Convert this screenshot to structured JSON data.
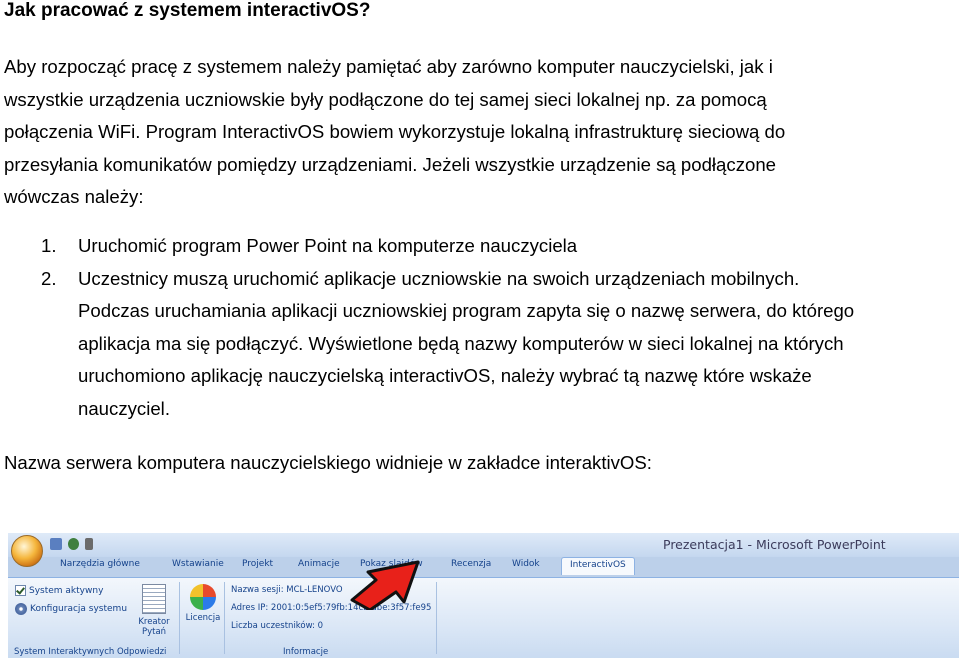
{
  "title": "Jak pracować z systemem interactivOS?",
  "intro_lines": [
    "Aby rozpocząć pracę z systemem należy pamiętać aby zarówno komputer nauczycielski, jak i",
    "wszystkie urządzenia uczniowskie były podłączone do tej samej sieci lokalnej np. za pomocą",
    "połączenia WiFi. Program InteractivOS bowiem wykorzystuje lokalną infrastrukturę sieciową do",
    "przesyłania komunikatów pomiędzy urządzeniami. Jeżeli wszystkie urządzenie są podłączone",
    "wówczas należy:"
  ],
  "steps": [
    {
      "number": "1.",
      "lines": [
        "Uruchomić program Power Point na komputerze nauczyciela"
      ]
    },
    {
      "number": "2.",
      "lines": [
        "Uczestnicy muszą uruchomić aplikacje uczniowskie na swoich urządzeniach mobilnych.",
        "Podczas uruchamiania aplikacji uczniowskiej program zapyta się o nazwę serwera, do którego",
        "aplikacja ma się podłączyć. Wyświetlone będą nazwy komputerów w sieci lokalnej na których",
        "uruchomiono aplikację nauczycielską interactivOS, należy wybrać tą nazwę które wskaże",
        "nauczyciel."
      ]
    }
  ],
  "server_caption": "Nazwa serwera komputera nauczycielskiego widnieje w zakładce interaktivOS:",
  "screenshot": {
    "window_title": "Prezentacja1 - Microsoft PowerPoint",
    "tabs": [
      "Narzędzia główne",
      "Wstawianie",
      "Projekt",
      "Animacje",
      "Pokaz slajdów",
      "Recenzja",
      "Widok",
      "InteractivOS"
    ],
    "active_tab": "InteractivOS",
    "group1": {
      "items": [
        "System aktywny",
        "Konfiguracja systemu"
      ],
      "label": "System Interaktywnych Odpowiedzi"
    },
    "kreator": "Kreator Pytań",
    "licencja": "Licencja",
    "info": {
      "session": "Nazwa sesji: MCL-LENOVO",
      "ip": "Adres IP: 2001:0:5ef5:79fb:14cb:dbe:3f57:fe95",
      "participants": "Liczba uczestników: 0",
      "label": "Informacje"
    },
    "colors": {
      "arrow": "#e8211a",
      "ribbon_text": "#15428b"
    }
  }
}
